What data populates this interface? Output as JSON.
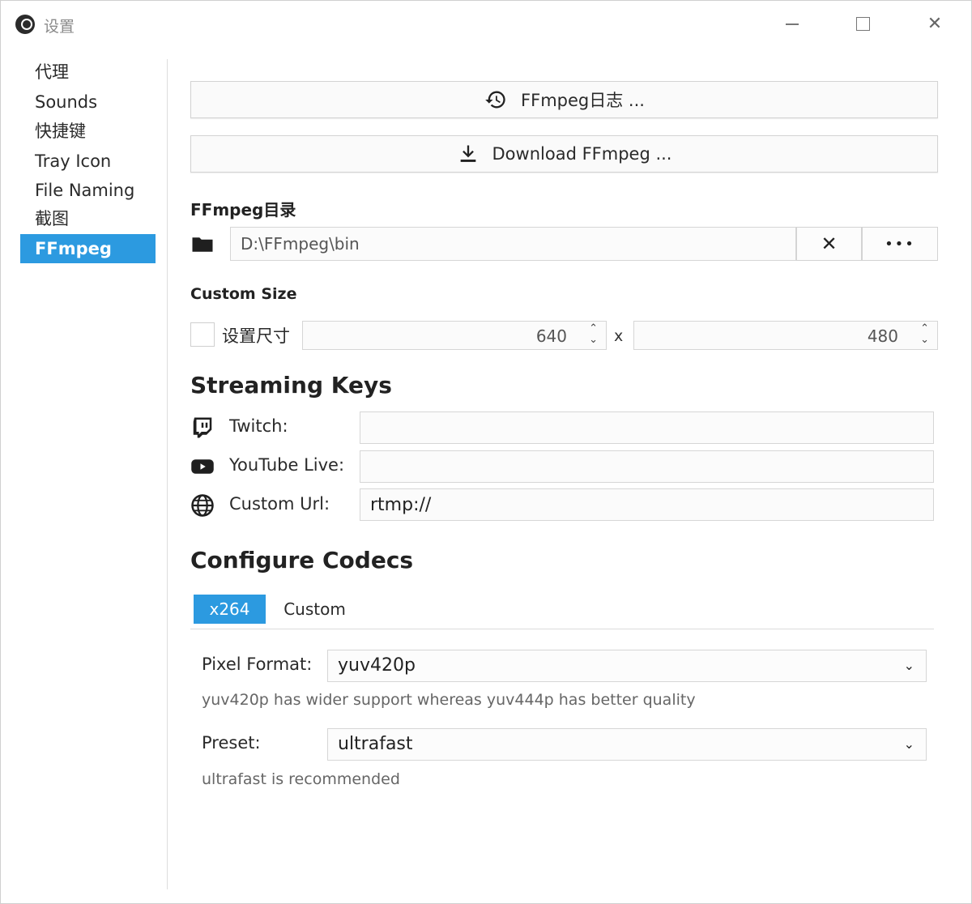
{
  "window": {
    "title": "设置",
    "minimize": "–",
    "maximize": "☐",
    "close": "✕"
  },
  "sidebar": {
    "items": [
      {
        "label": "代理"
      },
      {
        "label": "Sounds"
      },
      {
        "label": "快捷键"
      },
      {
        "label": "Tray Icon"
      },
      {
        "label": "File Naming"
      },
      {
        "label": "截图"
      },
      {
        "label": "FFmpeg",
        "active": true
      }
    ]
  },
  "actions": {
    "log_label": "FFmpeg日志 ...",
    "download_label": "Download FFmpeg ..."
  },
  "ffmpeg_dir": {
    "label": "FFmpeg目录",
    "value": "D:\\FFmpeg\\bin",
    "clear_label": "✕",
    "browse_label": "•••"
  },
  "custom_size": {
    "label": "Custom Size",
    "checkbox_label": "设置尺寸",
    "checked": false,
    "width": "640",
    "height": "480",
    "separator": "x"
  },
  "streaming": {
    "title": "Streaming Keys",
    "twitch_label": "Twitch:",
    "twitch_value": "",
    "youtube_label": "YouTube Live:",
    "youtube_value": "",
    "custom_label": "Custom Url:",
    "custom_value": "rtmp://"
  },
  "codecs": {
    "title": "Configure Codecs",
    "tabs": [
      {
        "label": "x264",
        "active": true
      },
      {
        "label": "Custom",
        "active": false
      }
    ],
    "pixel_format_label": "Pixel Format:",
    "pixel_format_value": "yuv420p",
    "pixel_format_hint": "yuv420p has wider support whereas yuv444p has better quality",
    "preset_label": "Preset:",
    "preset_value": "ultrafast",
    "preset_hint": "ultrafast is recommended"
  },
  "colors": {
    "accent": "#2c9ae0"
  },
  "icons": {
    "app": "app-logo-icon",
    "log": "history-icon",
    "download": "download-icon",
    "folder": "folder-icon",
    "twitch": "twitch-icon",
    "youtube": "youtube-icon",
    "globe": "globe-icon",
    "chevron": "chevron-down-icon"
  }
}
